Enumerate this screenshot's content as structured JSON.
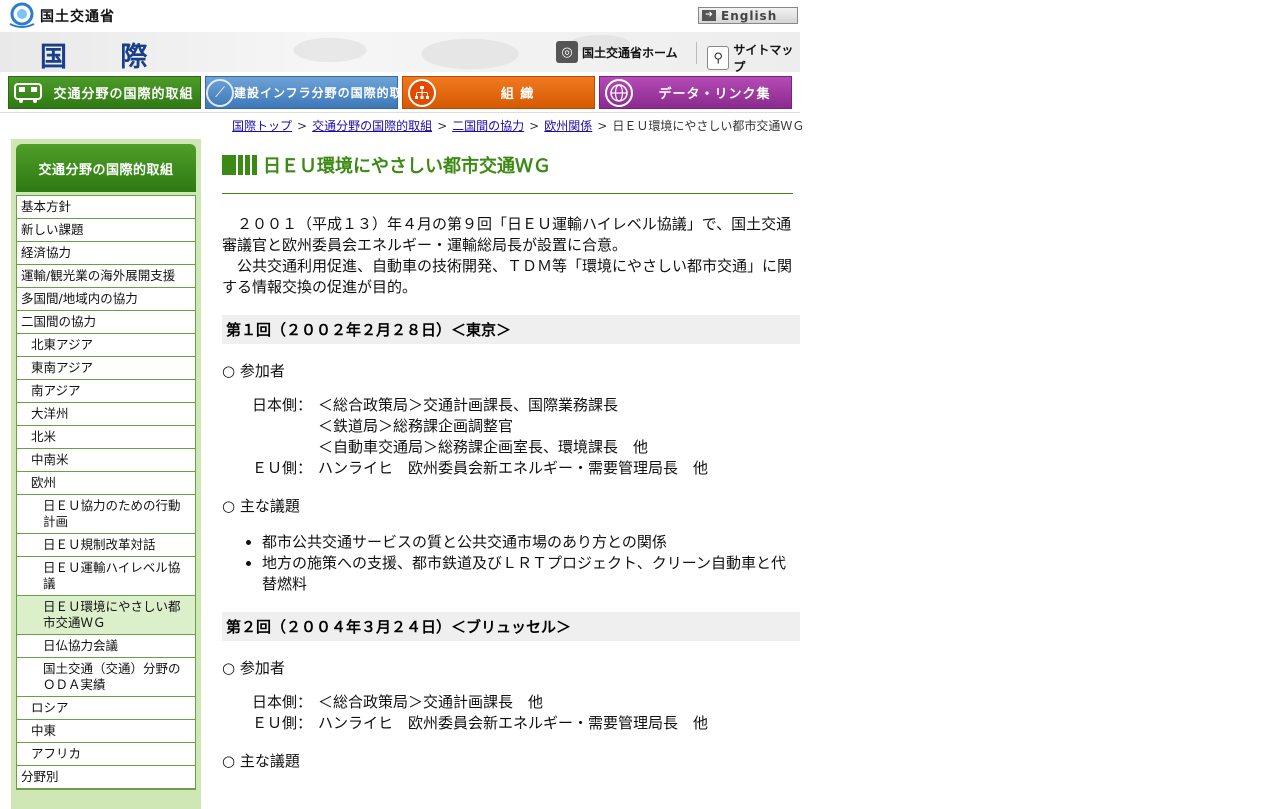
{
  "logo": {
    "text": "国土交通省"
  },
  "english": {
    "label": "English"
  },
  "header": {
    "title": "国 際",
    "home_label": "国土交通省ホーム",
    "sitemap_label": "サイトマップ"
  },
  "nav": {
    "items": [
      {
        "label": "交通分野の国際的取組",
        "icon": "train-icon"
      },
      {
        "label": "建設インフラ分野の国際的取組",
        "icon": "road-icon"
      },
      {
        "label": "組 織",
        "icon": "org-chart-icon"
      },
      {
        "label": "データ・リンク集",
        "icon": "globe-icon"
      }
    ]
  },
  "breadcrumb": {
    "items": [
      "国際トップ",
      "交通分野の国際的取組",
      "二国間の協力",
      "欧州関係"
    ],
    "current": "日ＥＵ環境にやさしい都市交通ＷＧ",
    "separator": ">"
  },
  "sidebar": {
    "title": "交通分野の国際的取組",
    "items": [
      {
        "label": "基本方針"
      },
      {
        "label": "新しい課題"
      },
      {
        "label": "経済協力"
      },
      {
        "label": "運輸/観光業の海外展開支援"
      },
      {
        "label": "多国間/地域内の協力"
      },
      {
        "label": "二国間の協力"
      },
      {
        "label": "北東アジア"
      },
      {
        "label": "東南アジア"
      },
      {
        "label": "南アジア"
      },
      {
        "label": "大洋州"
      },
      {
        "label": "北米"
      },
      {
        "label": "中南米"
      },
      {
        "label": "欧州"
      },
      {
        "label": "日ＥＵ協力のための行動計画"
      },
      {
        "label": "日ＥＵ規制改革対話"
      },
      {
        "label": "日ＥＵ運輸ハイレベル協議"
      },
      {
        "label": "日ＥＵ環境にやさしい都市交通ＷＧ"
      },
      {
        "label": "日仏協力会議"
      },
      {
        "label": "国土交通（交通）分野のＯＤＡ実績"
      },
      {
        "label": "ロシア"
      },
      {
        "label": "中東"
      },
      {
        "label": "アフリカ"
      },
      {
        "label": "分野別"
      }
    ]
  },
  "content": {
    "title": "日ＥＵ環境にやさしい都市交通ＷＧ",
    "intro": [
      "２００１（平成１３）年４月の第９回「日ＥＵ運輸ハイレベル協議」で、国土交通審議官と欧州委員会エネルギー・運輸総局長が設置に合意。",
      "公共交通利用促進、自動車の技術開発、ＴＤＭ等「環境にやさしい都市交通」に関する情報交換の促進が目的。"
    ],
    "sections": [
      {
        "heading": "第１回（２００２年２月２８日）＜東京＞",
        "participants_label": "○ 参加者",
        "japan_label": "日本側：",
        "japan": [
          "＜総合政策局＞交通計画課長、国際業務課長",
          "＜鉄道局＞総務課企画調整官",
          "＜自動車交通局＞総務課企画室長、環境課長　他"
        ],
        "eu_label": "ＥＵ側：",
        "eu": "ハンライヒ　欧州委員会新エネルギー・需要管理局長　他",
        "topics_label": "○ 主な議題",
        "topics": [
          "都市公共交通サービスの質と公共交通市場のあり方との関係",
          "地方の施策への支援、都市鉄道及びＬＲＴプロジェクト、クリーン自動車と代替燃料"
        ]
      },
      {
        "heading": "第２回（２００４年３月２４日）＜ブリュッセル＞",
        "participants_label": "○ 参加者",
        "japan_label": "日本側：",
        "japan": [
          "＜総合政策局＞交通計画課長　他"
        ],
        "eu_label": "ＥＵ側：",
        "eu": "ハンライヒ　欧州委員会新エネルギー・需要管理局長　他",
        "topics_label": "○ 主な議題"
      }
    ]
  }
}
